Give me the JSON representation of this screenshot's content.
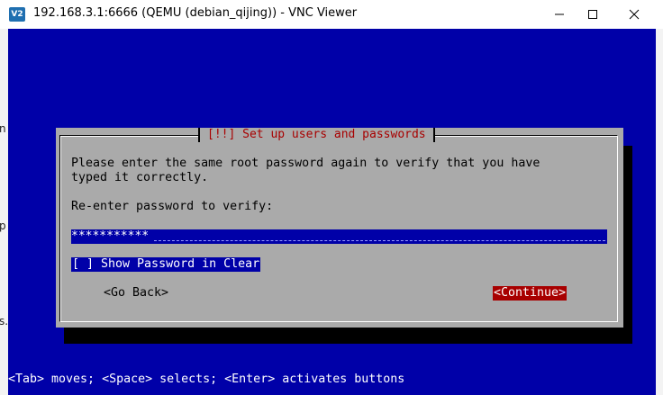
{
  "window": {
    "title": "192.168.3.1:6666 (QEMU (debian_qijing)) - VNC Viewer",
    "app_icon_text": "V2",
    "controls": {
      "minimize": "minimize-icon",
      "maximize": "maximize-icon",
      "close": "close-icon"
    }
  },
  "background_fragments": [
    "n",
    "p",
    "s."
  ],
  "dialog": {
    "title": "[!!] Set up users and passwords",
    "message_line1": "Please enter the same root password again to verify that you have",
    "message_line2": "typed it correctly.",
    "prompt": "Re-enter password to verify:",
    "password_mask": "***********",
    "checkbox_label": "[ ] Show Password in Clear",
    "back_button": "<Go Back>",
    "continue_button": "<Continue>"
  },
  "status_bar": "<Tab> moves; <Space> selects; <Enter> activates buttons",
  "colors": {
    "screen_bg": "#0000a8",
    "dialog_bg": "#aaaaaa",
    "title_red": "#a80000",
    "focus_button_bg": "#a80000"
  }
}
